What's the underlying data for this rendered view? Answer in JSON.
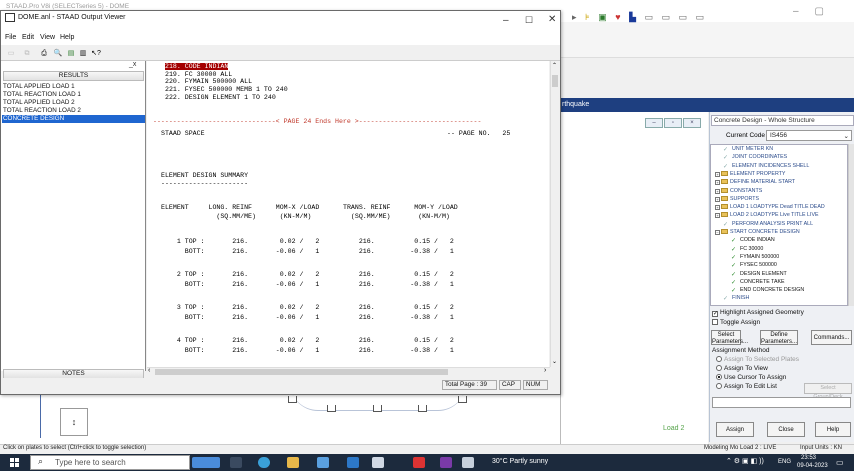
{
  "background_app": {
    "title": "STAAD.Pro V8i (SELECTseries 5) - DOME",
    "band_label": "rthquake",
    "load_label": "Load 2"
  },
  "viewer": {
    "title": "DOME.anl - STAAD Output Viewer",
    "menu": [
      "File",
      "Edit",
      "View",
      "Help"
    ],
    "results_header": "RESULTS",
    "results_items": [
      "TOTAL APPLIED LOAD   1",
      "TOTAL REACTION LOAD   1",
      "TOTAL APPLIED LOAD   2",
      "TOTAL REACTION LOAD   2",
      "CONCRETE DESIGN"
    ],
    "selected_result": "CONCRETE DESIGN",
    "notes_label": "NOTES",
    "output_lines": [
      "218. CODE INDIAN",
      "219. FC 30000 ALL",
      "220. FYMAIN 500000 ALL",
      "221. FYSEC 500000 MEMB 1 TO 240",
      "222. DESIGN ELEMENT 1 TO 240"
    ],
    "page_break": "-------------------------------< PAGE 24 Ends Here >-------------------------------",
    "staad_space": "STAAD SPACE",
    "page_no": "-- PAGE NO.   25",
    "summary_title": "ELEMENT DESIGN SUMMARY",
    "summary_underline": "----------------------",
    "col_header_1": "ELEMENT     LONG. REINF      MOM-X /LOAD      TRANS. REINF      MOM-Y /LOAD",
    "col_header_2": "              (SQ.MM/ME)      (KN-M/M)          (SQ.MM/ME)       (KN-M/M)",
    "rows": [
      [
        "    1 TOP :       216.        0.02 /   2          216.          0.15 /   2",
        "      BOTT:       216.       -0.06 /   1          216.         -0.38 /   1"
      ],
      [
        "    2 TOP :       216.        0.02 /   2          216.          0.15 /   2",
        "      BOTT:       216.       -0.06 /   1          216.         -0.38 /   1"
      ],
      [
        "    3 TOP :       216.        0.02 /   2          216.          0.15 /   2",
        "      BOTT:       216.       -0.06 /   1          216.         -0.38 /   1"
      ],
      [
        "    4 TOP :       216.        0.02 /   2          216.          0.15 /   2",
        "      BOTT:       216.       -0.06 /   1          216.         -0.38 /   1"
      ]
    ],
    "status": {
      "total_page": "Total Page :  39",
      "cap": "CAP",
      "num": "NUM"
    }
  },
  "right_panel": {
    "header": "Concrete Design - Whole Structure",
    "code_label": "Current Code",
    "code_value": "IS456",
    "tree": [
      {
        "label": "UNIT METER KN",
        "type": "check-gray",
        "indent": 1
      },
      {
        "label": "JOINT COORDINATES",
        "type": "check-gray",
        "indent": 1
      },
      {
        "label": "ELEMENT INCIDENCES SHELL",
        "type": "check-gray",
        "indent": 1
      },
      {
        "label": "ELEMENT PROPERTY",
        "type": "folder",
        "indent": 0
      },
      {
        "label": "DEFINE MATERIAL START",
        "type": "folder",
        "indent": 0
      },
      {
        "label": "CONSTANTS",
        "type": "folder",
        "indent": 0
      },
      {
        "label": "SUPPORTS",
        "type": "folder",
        "indent": 0
      },
      {
        "label": "LOAD 1 LOADTYPE Dead  TITLE DEAD",
        "type": "folder",
        "indent": 0
      },
      {
        "label": "LOAD 2 LOADTYPE Live  TITLE LIVE",
        "type": "folder",
        "indent": 0
      },
      {
        "label": "PERFORM ANALYSIS PRINT ALL",
        "type": "check-gray",
        "indent": 1
      },
      {
        "label": "START CONCRETE DESIGN",
        "type": "folder-open",
        "indent": 0
      },
      {
        "label": "CODE INDIAN",
        "type": "check",
        "indent": 2
      },
      {
        "label": "FC 30000",
        "type": "check",
        "indent": 2
      },
      {
        "label": "FYMAIN 500000",
        "type": "check",
        "indent": 2
      },
      {
        "label": "FYSEC 500000",
        "type": "check",
        "indent": 2
      },
      {
        "label": "DESIGN ELEMENT",
        "type": "check",
        "indent": 2
      },
      {
        "label": "CONCRETE TAKE",
        "type": "check",
        "indent": 2
      },
      {
        "label": "END CONCRETE DESIGN",
        "type": "check",
        "indent": 2
      },
      {
        "label": "FINISH",
        "type": "check-gray",
        "indent": 1
      }
    ],
    "highlight_label": "Highlight Assigned Geometry",
    "toggle_label": "Toggle Assign",
    "btn_select": [
      "Select",
      "Parameters..."
    ],
    "btn_define": [
      "Define",
      "Parameters..."
    ],
    "btn_commands": "Commands...",
    "method_label": "Assignment Method",
    "radios": [
      {
        "label": "Assign To Selected Plates",
        "state": "disabled"
      },
      {
        "label": "Assign To View",
        "state": "normal"
      },
      {
        "label": "Use Cursor To Assign",
        "state": "selected"
      },
      {
        "label": "Assign To Edit List",
        "state": "normal"
      }
    ],
    "select_group_label": "Select Group/Deck",
    "btn_assign": "Assign",
    "btn_close": "Close",
    "btn_help": "Help"
  },
  "app_status": {
    "hint": "Click on plates to select (Ctrl+click to toggle selection)",
    "mode": "Modeling Mo  Load 2 : LIVE",
    "units": "Input Units : KN"
  },
  "taskbar": {
    "search_placeholder": "Type here to search",
    "weather": "30°C  Partly sunny",
    "lang": "ENG",
    "time": "23:53",
    "date": "09-04-2023"
  }
}
